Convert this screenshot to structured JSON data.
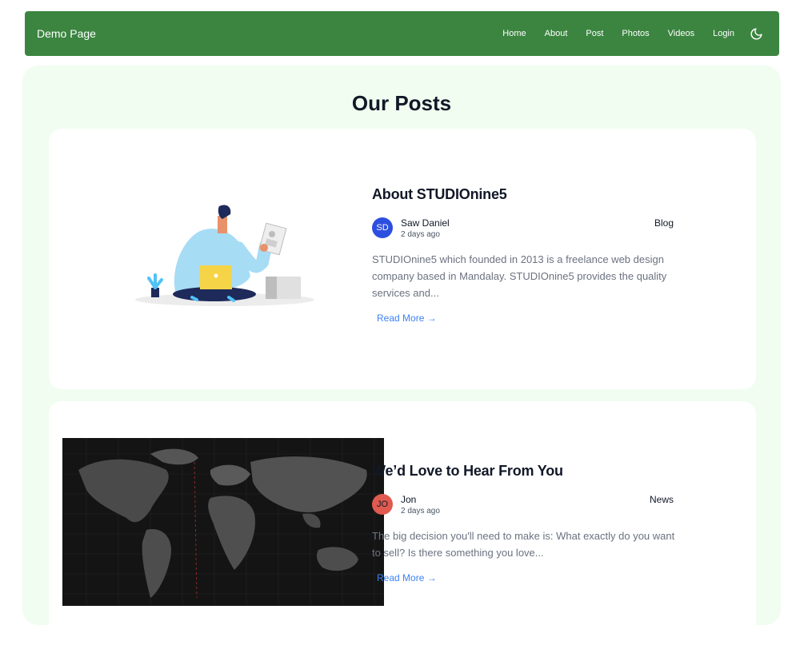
{
  "nav": {
    "brand": "Demo Page",
    "links": [
      "Home",
      "About",
      "Post",
      "Photos",
      "Videos",
      "Login"
    ]
  },
  "section": {
    "title": "Our Posts"
  },
  "posts": [
    {
      "title": "About STUDIOnine5",
      "author": "Saw Daniel",
      "initials": "SD",
      "time": "2 days ago",
      "category": "Blog",
      "excerpt": "STUDIOnine5 which founded in 2013 is a freelance web design company based in Mandalay. STUDIOnine5 provides the quality services and...",
      "read_more": "Read More →",
      "avatar_color": "#2d4fe0"
    },
    {
      "title": "We’d Love to Hear From You",
      "author": "Jon",
      "initials": "JO",
      "time": "2 days ago",
      "category": "News",
      "excerpt": "The big decision you'll need to make is: What exactly do you want to sell? Is there something you love...",
      "read_more": "Read More →",
      "avatar_color": "#e05a4f"
    }
  ],
  "colors": {
    "navbar": "#3b8540",
    "section_bg": "#f0fdf0",
    "link": "#3b82f6"
  }
}
